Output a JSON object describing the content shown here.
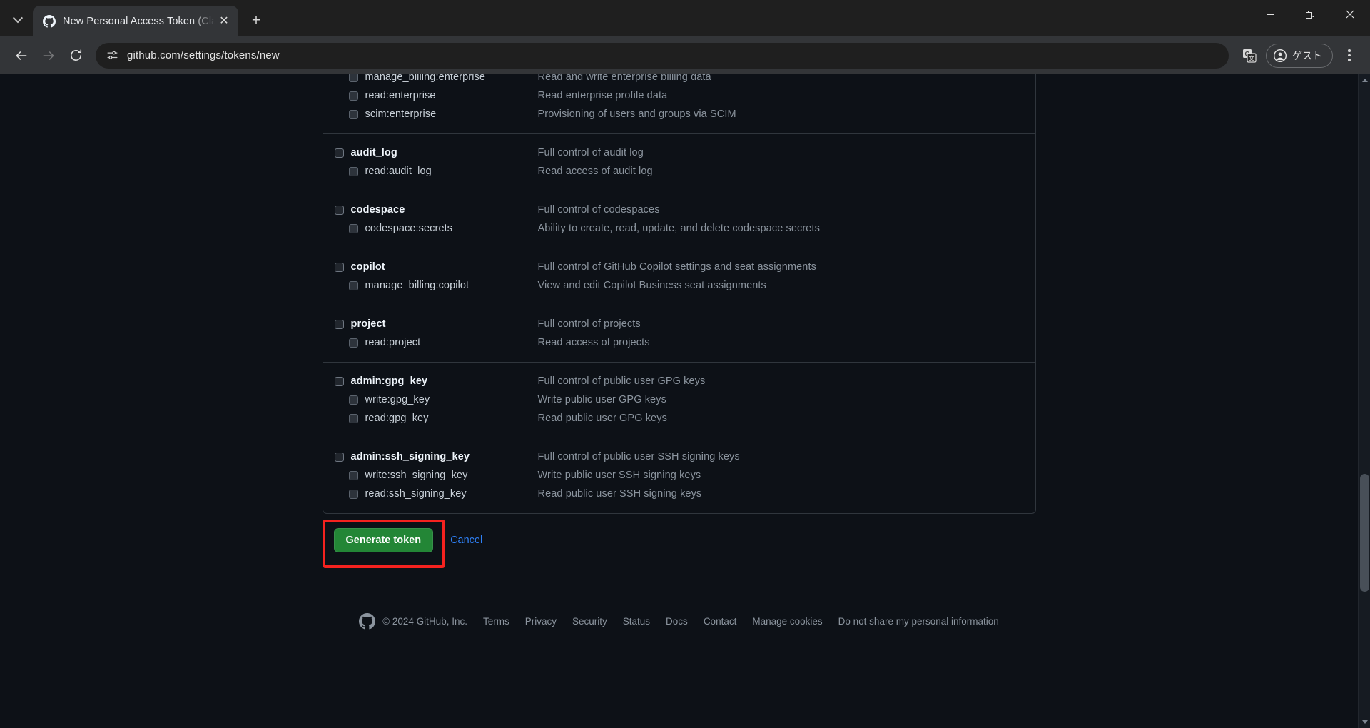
{
  "browser": {
    "tab": {
      "title": "New Personal Access Token (Cla",
      "favicon": "github-icon",
      "close_label": "✕"
    },
    "tab_list_label": "tab-list",
    "newtab_label": "+",
    "window_controls": {
      "minimize": "—",
      "restore": "restore-icon",
      "close": "✕"
    },
    "nav": {
      "back": "back-arrow-icon",
      "forward": "forward-arrow-icon",
      "reload": "reload-icon"
    },
    "omnibox": {
      "url": "github.com/settings/tokens/new",
      "site_icon": "site-settings-icon"
    },
    "translate_icon": "translate-icon",
    "profile": {
      "label": "ゲスト",
      "icon": "person-circle-icon"
    },
    "menu_icon": "three-dot-menu-icon"
  },
  "page": {
    "scope_groups": [
      {
        "rows": [
          {
            "level": "child",
            "name": "manage_billing:enterprise",
            "desc": "Read and write enterprise billing data",
            "checked": false
          },
          {
            "level": "child",
            "name": "read:enterprise",
            "desc": "Read enterprise profile data",
            "checked": false
          },
          {
            "level": "child",
            "name": "scim:enterprise",
            "desc": "Provisioning of users and groups via SCIM",
            "checked": false
          }
        ]
      },
      {
        "rows": [
          {
            "level": "parent",
            "name": "audit_log",
            "desc": "Full control of audit log",
            "checked": false
          },
          {
            "level": "child",
            "name": "read:audit_log",
            "desc": "Read access of audit log",
            "checked": false
          }
        ]
      },
      {
        "rows": [
          {
            "level": "parent",
            "name": "codespace",
            "desc": "Full control of codespaces",
            "checked": false
          },
          {
            "level": "child",
            "name": "codespace:secrets",
            "desc": "Ability to create, read, update, and delete codespace secrets",
            "checked": false
          }
        ]
      },
      {
        "rows": [
          {
            "level": "parent",
            "name": "copilot",
            "desc": "Full control of GitHub Copilot settings and seat assignments",
            "checked": false
          },
          {
            "level": "child",
            "name": "manage_billing:copilot",
            "desc": "View and edit Copilot Business seat assignments",
            "checked": false
          }
        ]
      },
      {
        "rows": [
          {
            "level": "parent",
            "name": "project",
            "desc": "Full control of projects",
            "checked": false
          },
          {
            "level": "child",
            "name": "read:project",
            "desc": "Read access of projects",
            "checked": false
          }
        ]
      },
      {
        "rows": [
          {
            "level": "parent",
            "name": "admin:gpg_key",
            "desc": "Full control of public user GPG keys",
            "checked": false
          },
          {
            "level": "child",
            "name": "write:gpg_key",
            "desc": "Write public user GPG keys",
            "checked": false
          },
          {
            "level": "child",
            "name": "read:gpg_key",
            "desc": "Read public user GPG keys",
            "checked": false
          }
        ]
      },
      {
        "rows": [
          {
            "level": "parent",
            "name": "admin:ssh_signing_key",
            "desc": "Full control of public user SSH signing keys",
            "checked": false
          },
          {
            "level": "child",
            "name": "write:ssh_signing_key",
            "desc": "Write public user SSH signing keys",
            "checked": false
          },
          {
            "level": "child",
            "name": "read:ssh_signing_key",
            "desc": "Read public user SSH signing keys",
            "checked": false
          }
        ]
      }
    ],
    "actions": {
      "generate_label": "Generate token",
      "cancel_label": "Cancel",
      "highlight_color": "#f5221f",
      "generate_color": "#238636"
    },
    "footer": {
      "logo": "github-mark-icon",
      "copyright": "© 2024 GitHub, Inc.",
      "links": [
        "Terms",
        "Privacy",
        "Security",
        "Status",
        "Docs",
        "Contact",
        "Manage cookies",
        "Do not share my personal information"
      ]
    }
  }
}
